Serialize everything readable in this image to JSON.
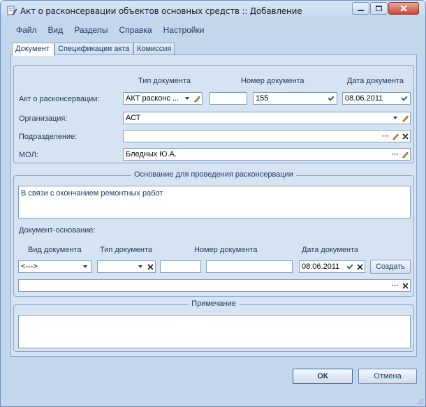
{
  "window": {
    "title": "Акт о расконсервации объектов основных средств :: Добавление"
  },
  "menu": [
    {
      "label": "Файл"
    },
    {
      "label": "Вид"
    },
    {
      "label": "Разделы"
    },
    {
      "label": "Справка"
    },
    {
      "label": "Настройки"
    }
  ],
  "tabs": [
    {
      "label": "Документ",
      "active": true
    },
    {
      "label": "Спецификация акта",
      "active": false
    },
    {
      "label": "Комиссия",
      "active": false
    }
  ],
  "header_fields": {
    "col_doc_type": "Тип документа",
    "col_doc_number": "Номер документа",
    "col_doc_date": "Дата документа",
    "act_label": "Акт о расконсервации:",
    "act_type_value": "АКТ расконс ...",
    "act_prefix_value": "",
    "act_number_value": "155",
    "act_date_value": "08.06.2011",
    "org_label": "Организация:",
    "org_value": "АСТ",
    "dept_label": "Подразделение:",
    "dept_value": "",
    "mol_label": "МОЛ:",
    "mol_value": "Бледных Ю.А."
  },
  "basis_group": {
    "title": "Основание для проведения расконсервации",
    "reason_text": "В связи с окончанием ремонтных работ",
    "doc_basis_label": "Документ-основание:",
    "col_view": "Вид документа",
    "col_type": "Тип документа",
    "col_number": "Номер документа",
    "col_date": "Дата документа",
    "view_value": "<--->",
    "type_value": "",
    "prefix_value": "",
    "number_value": "",
    "date_value": "08.06.2011",
    "create_label": "Создать",
    "basis_value": ""
  },
  "note_group": {
    "title": "Примечание",
    "text": ""
  },
  "footer": {
    "ok_label": "ОК",
    "cancel_label": "Отмена"
  }
}
